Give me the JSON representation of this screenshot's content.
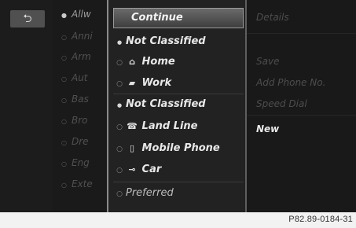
{
  "back": {
    "icon": "back-arrow-icon",
    "glyph": "⮌"
  },
  "categories": [
    {
      "label": "Allw",
      "selected": true
    },
    {
      "label": "Anni",
      "selected": false
    },
    {
      "label": "Arm",
      "selected": false
    },
    {
      "label": "Aut",
      "selected": false
    },
    {
      "label": "Bas",
      "selected": false
    },
    {
      "label": "Bro",
      "selected": false
    },
    {
      "label": "Dre",
      "selected": false
    },
    {
      "label": "Eng",
      "selected": false
    },
    {
      "label": "Exte",
      "selected": false
    }
  ],
  "popup": {
    "continue_label": "Continue",
    "items": [
      {
        "label": "Not Classified",
        "mark": "●",
        "icon": "",
        "icon_name": ""
      },
      {
        "label": "Home",
        "mark": "○",
        "icon": "⌂",
        "icon_name": "home-icon"
      },
      {
        "label": "Work",
        "mark": "○",
        "icon": "▰",
        "icon_name": "work-icon"
      },
      {
        "label": "Not Classified",
        "mark": "●",
        "icon": "",
        "icon_name": ""
      },
      {
        "label": "Land Line",
        "mark": "○",
        "icon": "☎",
        "icon_name": "landline-icon"
      },
      {
        "label": "Mobile Phone",
        "mark": "○",
        "icon": "▯",
        "icon_name": "mobile-phone-icon"
      },
      {
        "label": "Car",
        "mark": "○",
        "icon": "⊸",
        "icon_name": "car-icon"
      },
      {
        "label": "Preferred",
        "mark": "○",
        "icon": "",
        "icon_name": ""
      }
    ]
  },
  "options": [
    {
      "label": "Details",
      "active": false
    },
    {
      "label": "Save",
      "active": false
    },
    {
      "label": "Add Phone No.",
      "active": false
    },
    {
      "label": "Speed Dial",
      "active": false
    },
    {
      "label": "New",
      "active": true
    }
  ],
  "footer": {
    "reference": "P82.89-0184-31"
  }
}
